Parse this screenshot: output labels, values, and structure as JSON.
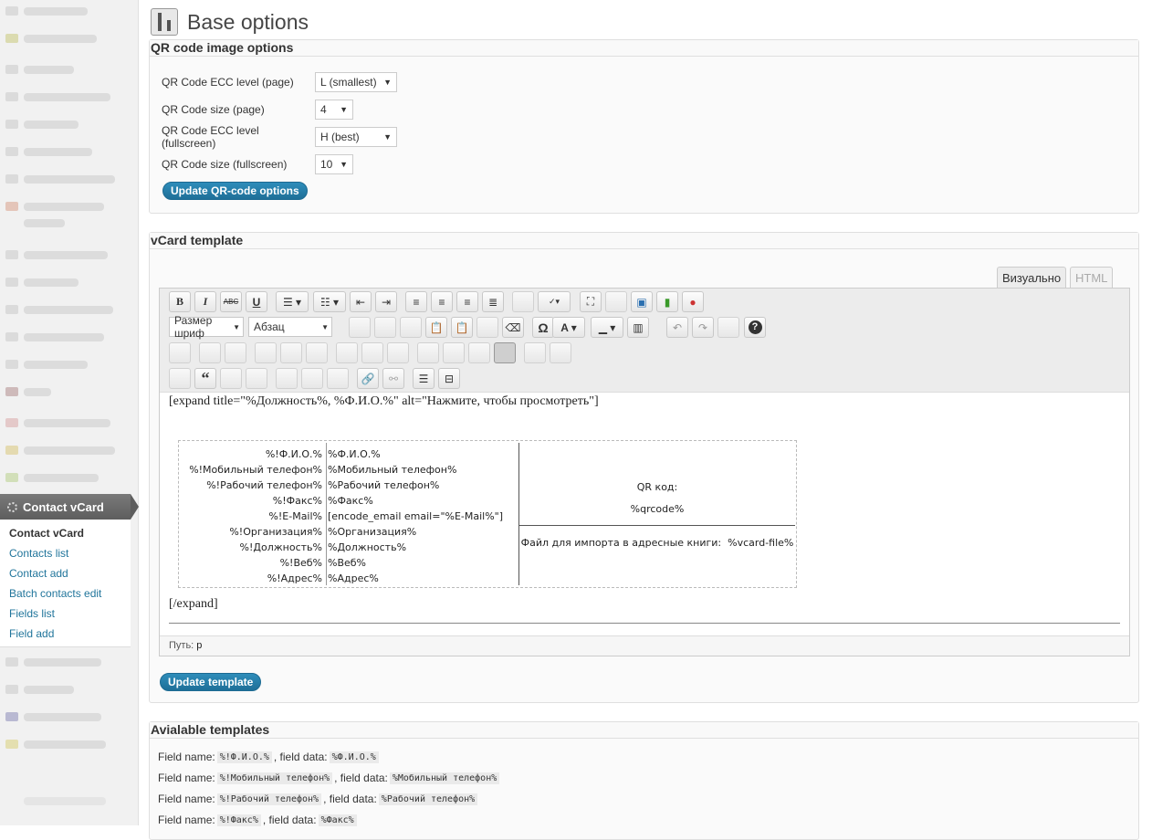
{
  "sidebar": {
    "active_menu": "Contact vCard",
    "submenu": [
      "Contact vCard",
      "Contacts list",
      "Contact add",
      "Batch contacts edit",
      "Fields list",
      "Field add"
    ]
  },
  "page": {
    "title": "Base options"
  },
  "qr_box": {
    "title": "QR code image options",
    "rows": [
      {
        "label": "QR Code ECC level (page)",
        "value": "L (smallest)"
      },
      {
        "label": "QR Code size (page)",
        "value": "4"
      },
      {
        "label": "QR Code ECC level (fullscreen)",
        "value": "H (best)"
      },
      {
        "label": "QR Code size (fullscreen)",
        "value": "10"
      }
    ],
    "button": "Update QR-code options"
  },
  "vcard_box": {
    "title": "vCard template",
    "tab_visual": "Визуально",
    "tab_html": "HTML",
    "toolbar": {
      "font_size": "Размер шриф",
      "format": "Абзац",
      "bold": "B",
      "italic": "I",
      "strike": "ABC",
      "underline": "U",
      "omega": "Ω",
      "quote": "“",
      "help": "?"
    },
    "content": {
      "expand_open": "[expand title=\"%Должность%, %Ф.И.О.%\" alt=\"Нажмите, чтобы просмотреть\"]",
      "expand_close": "[/expand]",
      "table_rows": [
        {
          "left": "%!Ф.И.О.%",
          "right": "%Ф.И.О.%"
        },
        {
          "left": "%!Мобильный телефон%",
          "right": "%Мобильный телефон%"
        },
        {
          "left": "%!Рабочий телефон%",
          "right": "%Рабочий телефон%"
        },
        {
          "left": "%!Факс%",
          "right": "%Факс%"
        },
        {
          "left": "%!E-Mail%",
          "right": "[encode_email email=\"%E-Mail%\"]"
        },
        {
          "left": "%!Организация%",
          "right": "%Организация%"
        },
        {
          "left": "%!Должность%",
          "right": "%Должность%"
        },
        {
          "left": "%!Веб%",
          "right": "%Веб%"
        },
        {
          "left": "%!Адрес%",
          "right": "%Адрес%"
        }
      ],
      "qr_label": "QR код:",
      "qr_value": "%qrcode%",
      "import_text": "Файл для импорта в адресные книги:  %vcard-file%"
    },
    "path_label": "Путь:",
    "path_value": "p",
    "button": "Update template"
  },
  "templates_box": {
    "title": "Avialable templates",
    "field_name_label": "Field name:",
    "field_data_label": ", field data:",
    "items": [
      {
        "name": "%!Ф.И.О.%",
        "data": "%Ф.И.О.%"
      },
      {
        "name": "%!Мобильный телефон%",
        "data": "%Мобильный телефон%"
      },
      {
        "name": "%!Рабочий телефон%",
        "data": "%Рабочий телефон%"
      },
      {
        "name": "%!Факс%",
        "data": "%Факс%"
      }
    ]
  },
  "colors": {
    "accent": "#21759b",
    "button": "#2580ad"
  }
}
